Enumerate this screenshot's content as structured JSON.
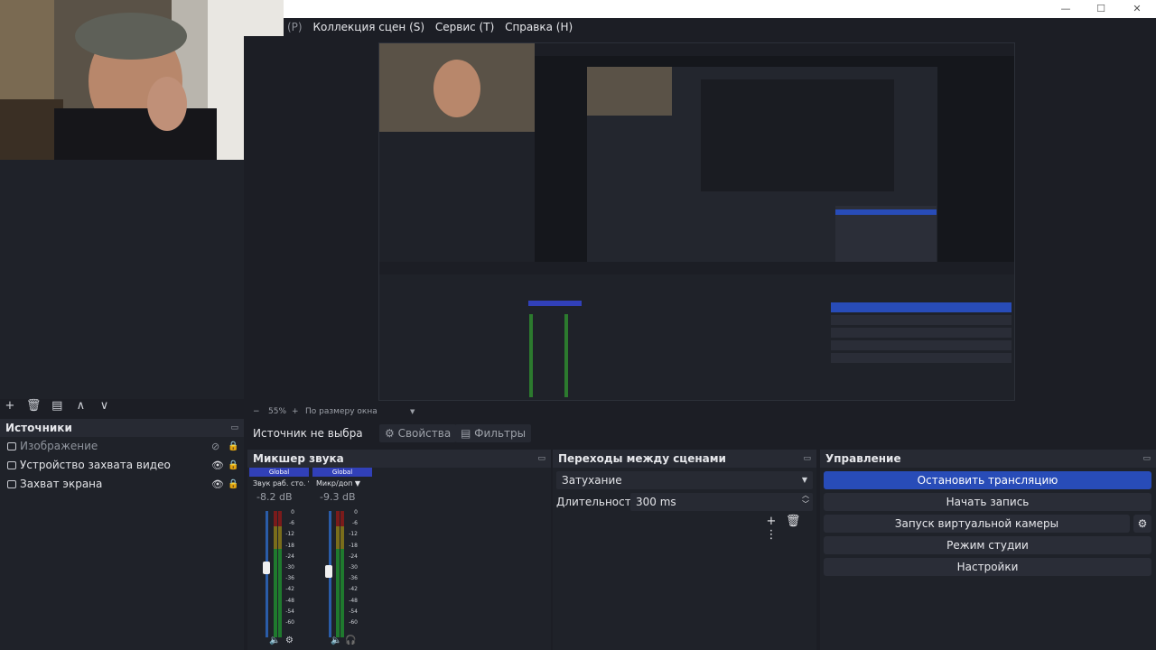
{
  "menu": {
    "partial": "(P)",
    "scene_collection": "Коллекция сцен (S)",
    "tools": "Сервис (T)",
    "help": "Справка (H)"
  },
  "window": {
    "minimize": "—",
    "maximize": "☐",
    "close": "✕"
  },
  "preview": {
    "zoom_minus": "−",
    "zoom_value": "55%",
    "zoom_plus": "+",
    "scale_mode": "По размеру окна"
  },
  "sources": {
    "title": "Источники",
    "items": [
      {
        "label": "Изображение",
        "visible": false
      },
      {
        "label": "Устройство захвата видео",
        "visible": true
      },
      {
        "label": "Захват экрана",
        "visible": true
      }
    ],
    "toolbar": {
      "add": "+",
      "remove": "🗑",
      "filter": "▤",
      "up": "∧",
      "down": "∨"
    }
  },
  "properties_bar": {
    "no_source": "Источник не выбра",
    "properties_tab": "Свойства",
    "filters_tab": "Фильтры"
  },
  "mixer": {
    "title": "Микшер звука",
    "channels": [
      {
        "badge": "Global",
        "name": "Звук раб. сто.",
        "db": "-8.2 dB",
        "level": 0.55
      },
      {
        "badge": "Global",
        "name": "Микр/доп",
        "db": "-9.3 dB",
        "level": 0.58
      }
    ],
    "scale": [
      "0",
      "-6",
      "-12",
      "-18",
      "-24",
      "-30",
      "-36",
      "-42",
      "-48",
      "-54",
      "-60"
    ]
  },
  "transitions": {
    "title": "Переходы между сценами",
    "type": "Затухание",
    "duration_label": "Длительность",
    "duration_value": "300 ms"
  },
  "controls": {
    "title": "Управление",
    "stop_stream": "Остановить трансляцию",
    "start_record": "Начать запись",
    "virtual_camera": "Запуск виртуальной камеры",
    "studio_mode": "Режим студии",
    "settings": "Настройки"
  },
  "colors": {
    "accent": "#284cb8",
    "panel": "#1f2229",
    "background": "#1c1e25"
  }
}
